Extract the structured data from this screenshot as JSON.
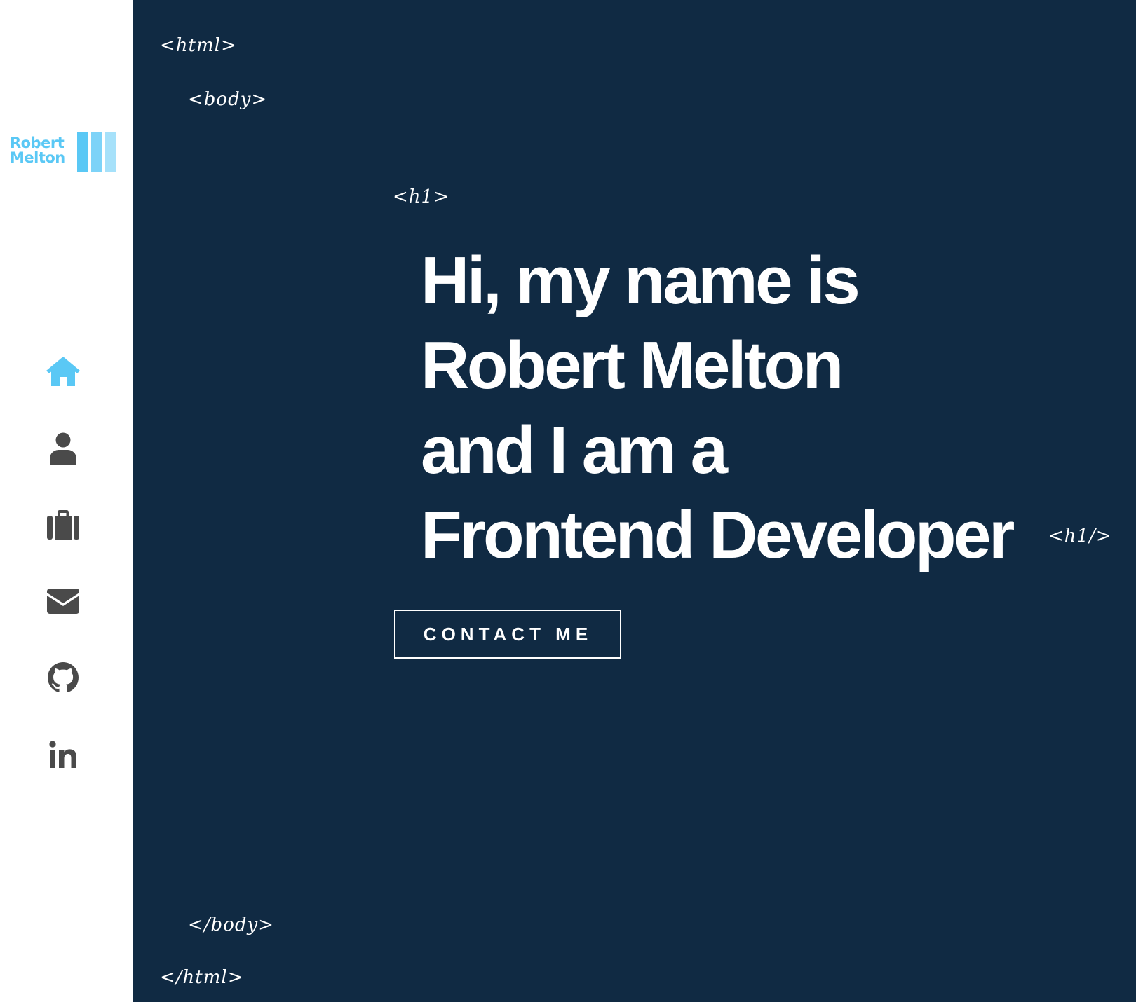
{
  "logo": {
    "line1": "Robert",
    "line2": "Melton",
    "color": "#5ac8f5",
    "bar_colors": [
      "#5ac8f5",
      "#7dd3f8",
      "#a6e1fa"
    ]
  },
  "nav": {
    "items": [
      {
        "name": "home",
        "icon": "home-icon",
        "active": true
      },
      {
        "name": "about",
        "icon": "user-icon",
        "active": false
      },
      {
        "name": "portfolio",
        "icon": "briefcase-icon",
        "active": false
      },
      {
        "name": "contact",
        "icon": "envelope-icon",
        "active": false
      },
      {
        "name": "github",
        "icon": "github-icon",
        "active": false
      },
      {
        "name": "linkedin",
        "icon": "linkedin-icon",
        "active": false
      }
    ],
    "active_color": "#5ac8f5",
    "inactive_color": "#4a4a4a"
  },
  "tags": {
    "html_open": "<html>",
    "body_open": "<body>",
    "h1_open": "<h1>",
    "h1_close": "<h1/>",
    "body_close": "</body>",
    "html_close": "</html>"
  },
  "hero": {
    "line1": "Hi, my name is",
    "line2": "Robert Melton",
    "line3": "and I am a",
    "line4": "Frontend Developer",
    "cta_label": "CONTACT ME"
  },
  "colors": {
    "background": "#102a43",
    "sidebar": "#ffffff",
    "text": "#ffffff"
  }
}
